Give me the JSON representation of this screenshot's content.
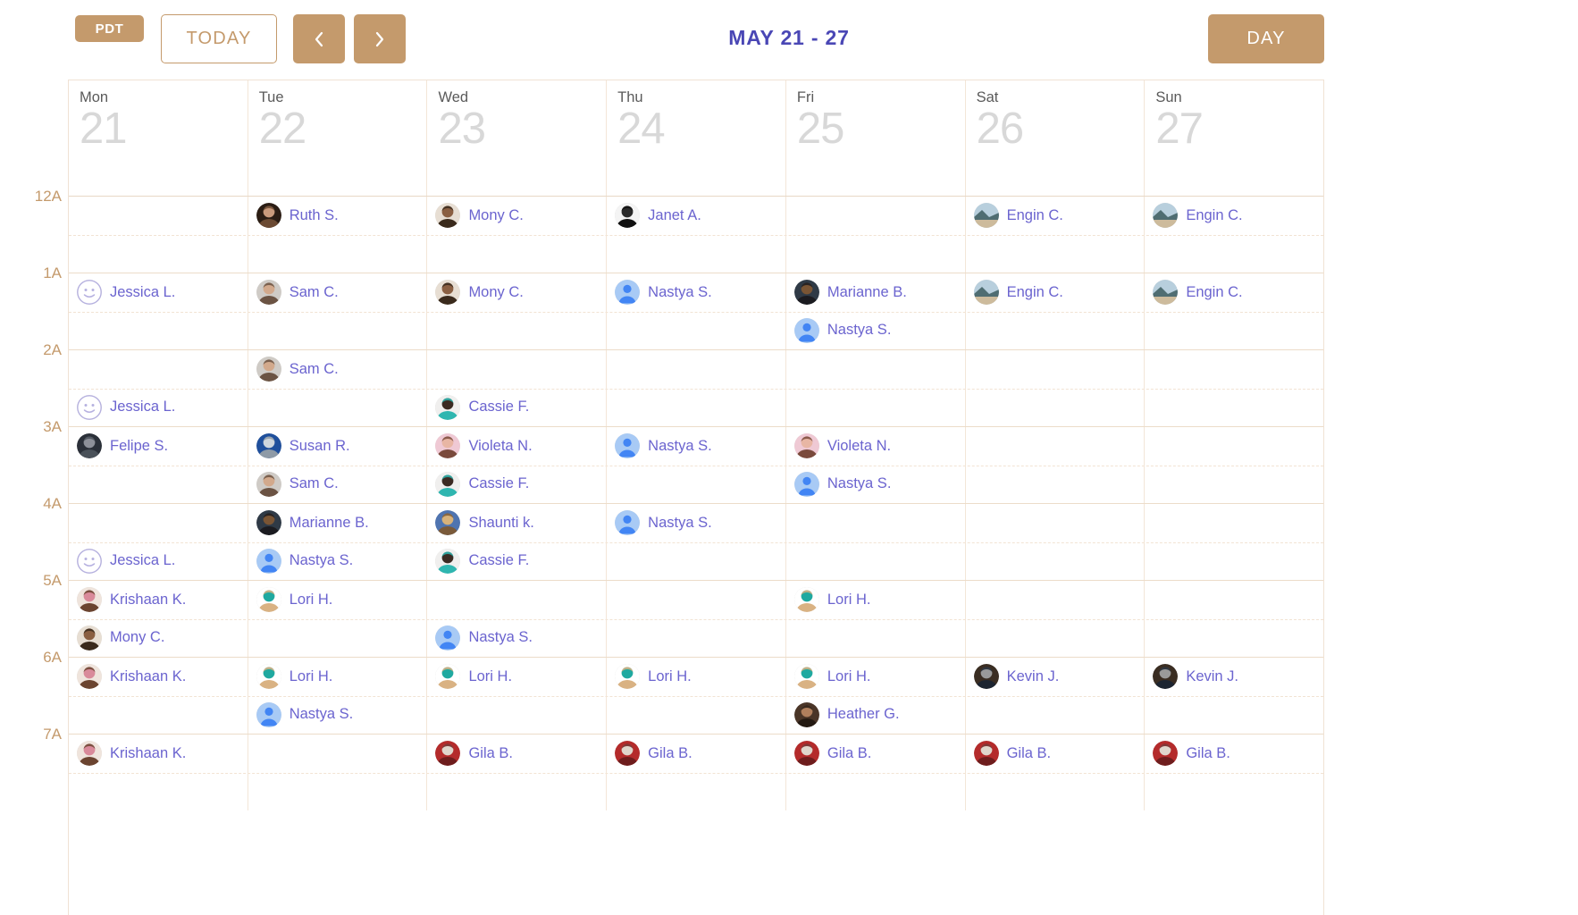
{
  "toolbar": {
    "timezone_badge": "PDT",
    "today_label": "TODAY",
    "prev_icon": "chevron-left-icon",
    "next_icon": "chevron-right-icon",
    "range_title": "MAY 21 - 27",
    "view_label": "DAY",
    "accent_color": "#c49a6c",
    "title_color": "#4a47b5"
  },
  "columns": [
    {
      "dayname": "Mon",
      "daynum": "21"
    },
    {
      "dayname": "Tue",
      "daynum": "22"
    },
    {
      "dayname": "Wed",
      "daynum": "23"
    },
    {
      "dayname": "Thu",
      "daynum": "24"
    },
    {
      "dayname": "Fri",
      "daynum": "25"
    },
    {
      "dayname": "Sat",
      "daynum": "26"
    },
    {
      "dayname": "Sun",
      "daynum": "27"
    }
  ],
  "hour_labels": [
    "12A",
    "1A",
    "2A",
    "3A",
    "4A",
    "5A",
    "6A",
    "7A"
  ],
  "event_name_color": "#6b64cf",
  "schedule": [
    {
      "hour": "12A",
      "slots": [
        {
          "half": "top",
          "cells": [
            null,
            "Ruth S.",
            "Mony C.",
            "Janet A.",
            null,
            "Engin C.",
            "Engin C."
          ]
        },
        {
          "half": "bottom",
          "cells": [
            null,
            null,
            null,
            null,
            null,
            null,
            null
          ]
        }
      ]
    },
    {
      "hour": "1A",
      "slots": [
        {
          "half": "top",
          "cells": [
            "Jessica L.",
            "Sam C.",
            "Mony C.",
            "Nastya S.",
            "Marianne B.",
            "Engin C.",
            "Engin C."
          ]
        },
        {
          "half": "bottom",
          "cells": [
            null,
            null,
            null,
            null,
            "Nastya S.",
            null,
            null
          ]
        }
      ]
    },
    {
      "hour": "2A",
      "slots": [
        {
          "half": "top",
          "cells": [
            null,
            "Sam C.",
            null,
            null,
            null,
            null,
            null
          ]
        },
        {
          "half": "bottom",
          "cells": [
            "Jessica L.",
            null,
            "Cassie F.",
            null,
            null,
            null,
            null
          ]
        }
      ]
    },
    {
      "hour": "3A",
      "slots": [
        {
          "half": "top",
          "cells": [
            "Felipe S.",
            "Susan R.",
            "Violeta N.",
            "Nastya S.",
            "Violeta N.",
            null,
            null
          ]
        },
        {
          "half": "bottom",
          "cells": [
            null,
            "Sam C.",
            "Cassie F.",
            null,
            "Nastya S.",
            null,
            null
          ]
        }
      ]
    },
    {
      "hour": "4A",
      "slots": [
        {
          "half": "top",
          "cells": [
            null,
            "Marianne B.",
            "Shaunti k.",
            "Nastya S.",
            null,
            null,
            null
          ]
        },
        {
          "half": "bottom",
          "cells": [
            "Jessica L.",
            "Nastya S.",
            "Cassie F.",
            null,
            null,
            null,
            null
          ]
        }
      ]
    },
    {
      "hour": "5A",
      "slots": [
        {
          "half": "top",
          "cells": [
            "Krishaan K.",
            "Lori H.",
            null,
            null,
            "Lori H.",
            null,
            null
          ]
        },
        {
          "half": "bottom",
          "cells": [
            "Mony C.",
            null,
            "Nastya S.",
            null,
            null,
            null,
            null
          ]
        }
      ]
    },
    {
      "hour": "6A",
      "slots": [
        {
          "half": "top",
          "cells": [
            "Krishaan K.",
            "Lori H.",
            "Lori H.",
            "Lori H.",
            "Lori H.",
            "Kevin J.",
            "Kevin J."
          ]
        },
        {
          "half": "bottom",
          "cells": [
            null,
            "Nastya S.",
            null,
            null,
            "Heather G.",
            null,
            null
          ]
        }
      ]
    },
    {
      "hour": "7A",
      "slots": [
        {
          "half": "top",
          "cells": [
            "Krishaan K.",
            null,
            "Gila B.",
            "Gila B.",
            "Gila B.",
            "Gila B.",
            "Gila B."
          ]
        },
        {
          "half": "bottom",
          "cells": [
            null,
            null,
            null,
            null,
            null,
            null,
            null
          ]
        }
      ]
    }
  ],
  "avatars": {
    "Ruth S.": {
      "type": "photo",
      "style": "portrait-woman-brown-hair",
      "c1": "#2b1d14",
      "c2": "#c99a7c",
      "c3": "#6b4a33"
    },
    "Mony C.": {
      "type": "photo",
      "style": "portrait-man-white-shirt",
      "c1": "#e7ded3",
      "c2": "#8a5f42",
      "c3": "#3a2a1c"
    },
    "Janet A.": {
      "type": "photo",
      "style": "portrait-dark-sketch",
      "c1": "#f4f4f4",
      "c2": "#2a2a2a",
      "c3": "#111111"
    },
    "Engin C.": {
      "type": "photo",
      "style": "landscape-beach",
      "c1": "#b8cfdd",
      "c2": "#4f6d72",
      "c3": "#cdbb9c"
    },
    "Jessica L.": {
      "type": "placeholder",
      "style": "smiley-face",
      "c1": "#e8e6f5",
      "c2": "#b6b1e0",
      "c3": "#b6b1e0"
    },
    "Sam C.": {
      "type": "photo",
      "style": "portrait-bald-man",
      "c1": "#cfcbc6",
      "c2": "#d2a98c",
      "c3": "#6b5343"
    },
    "Nastya S.": {
      "type": "placeholder",
      "style": "default-person",
      "c1": "#a8caf5",
      "c2": "#4285f4",
      "c3": "#4285f4"
    },
    "Marianne B.": {
      "type": "photo",
      "style": "portrait-curly-dark",
      "c1": "#2f3a46",
      "c2": "#7a5534",
      "c3": "#1b1b20"
    },
    "Felipe S.": {
      "type": "photo",
      "style": "portrait-dark-bg",
      "c1": "#2b3039",
      "c2": "#8d9099",
      "c3": "#4a5159"
    },
    "Susan R.": {
      "type": "photo",
      "style": "portrait-blue-bg",
      "c1": "#1f4f9c",
      "c2": "#cfd6dd",
      "c3": "#8e9aa6"
    },
    "Violeta N.": {
      "type": "photo",
      "style": "portrait-pink-bg",
      "c1": "#efc9d4",
      "c2": "#e8b6a4",
      "c3": "#7a4a3c"
    },
    "Cassie F.": {
      "type": "photo",
      "style": "portrait-light-bg-teal",
      "c1": "#f0efee",
      "c2": "#3b2a22",
      "c3": "#2fb6b0"
    },
    "Shaunti k.": {
      "type": "photo",
      "style": "portrait-blonde-blue-bg",
      "c1": "#4f74b0",
      "c2": "#d8b27a",
      "c3": "#7a5a3a"
    },
    "Krishaan K.": {
      "type": "photo",
      "style": "portrait-two-people-pink",
      "c1": "#efe4dc",
      "c2": "#d98a9a",
      "c3": "#6b4430"
    },
    "Lori H.": {
      "type": "photo",
      "style": "portrait-blonde-teal-top",
      "c1": "#ffffff",
      "c2": "#1fa9a0",
      "c3": "#d9b283"
    },
    "Kevin J.": {
      "type": "photo",
      "style": "portrait-man-dark-bg",
      "c1": "#3a2d22",
      "c2": "#9a9a9a",
      "c3": "#1c2430"
    },
    "Heather G.": {
      "type": "photo",
      "style": "portrait-dark-warm",
      "c1": "#4a3527",
      "c2": "#b07f5c",
      "c3": "#241a12"
    },
    "Gila B.": {
      "type": "photo",
      "style": "portrait-red-dress",
      "c1": "#b42b2b",
      "c2": "#e0d6cc",
      "c3": "#6e1d1d"
    }
  }
}
